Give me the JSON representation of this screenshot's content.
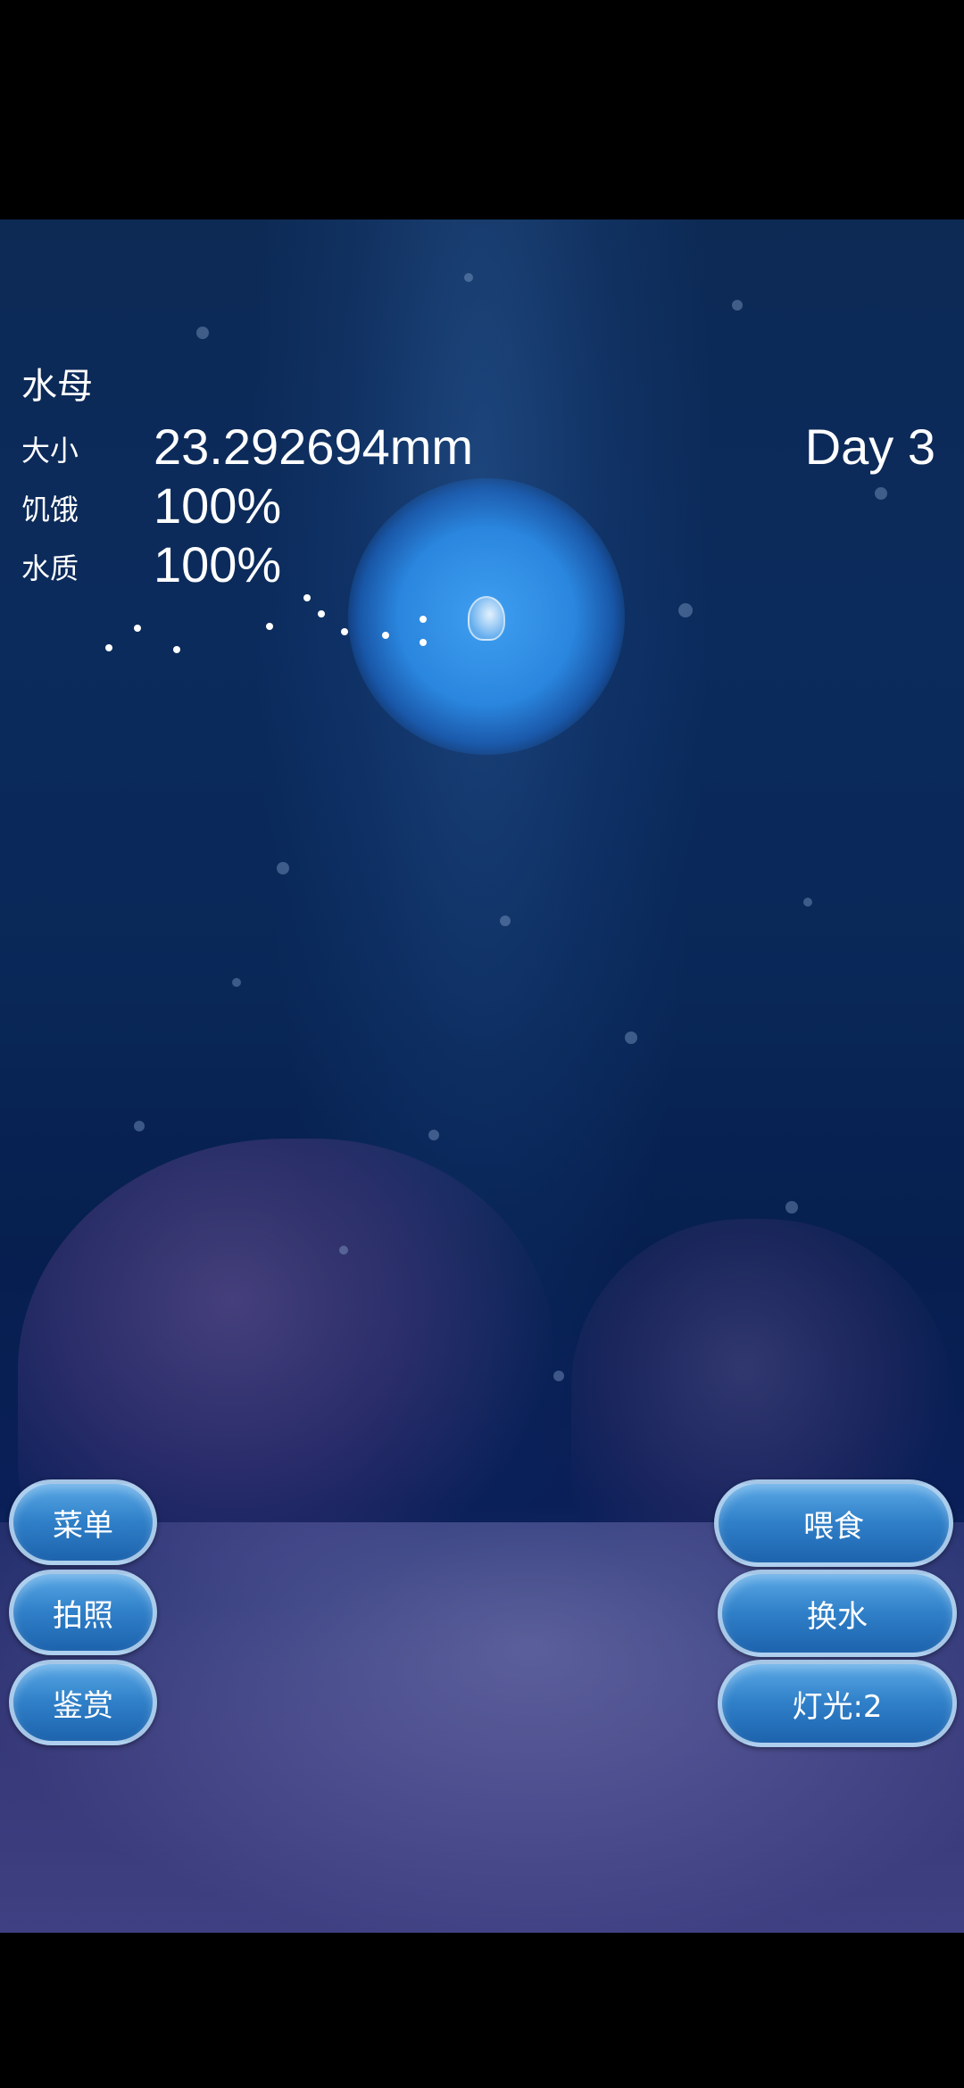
{
  "stats": {
    "title": "水母",
    "size_label": "大小",
    "size_value": "23.292694mm",
    "hunger_label": "饥饿",
    "hunger_value": "100%",
    "water_label": "水质",
    "water_value": "100%",
    "day": "Day 3"
  },
  "left_buttons": {
    "menu": "菜单",
    "photo": "拍照",
    "appreciate": "鉴赏"
  },
  "right_buttons": {
    "feed": "喂食",
    "change_water": "换水",
    "light": "灯光:2"
  },
  "colors": {
    "water_top": "#0d2a55",
    "water_bottom": "#3a3c7c",
    "button_fill": "#2f7fc8",
    "glow": "#3f9ff0"
  }
}
